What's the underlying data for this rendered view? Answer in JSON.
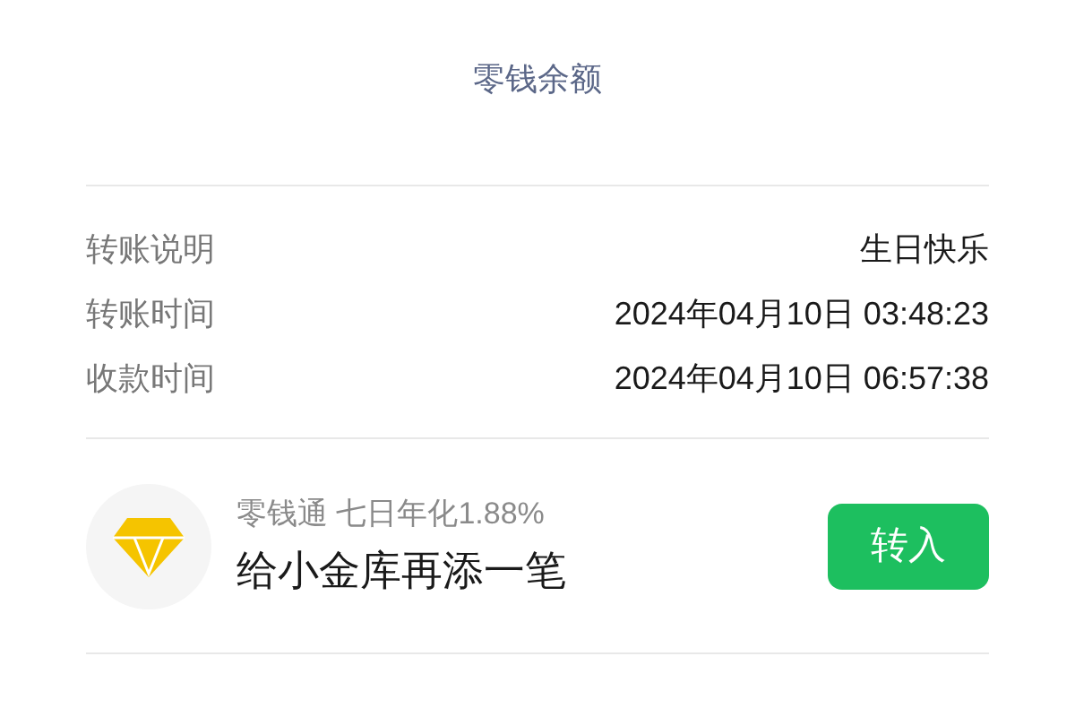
{
  "title": "零钱余额",
  "details": [
    {
      "label": "转账说明",
      "value": "生日快乐"
    },
    {
      "label": "转账时间",
      "value": "2024年04月10日 03:48:23"
    },
    {
      "label": "收款时间",
      "value": "2024年04月10日 06:57:38"
    }
  ],
  "promo": {
    "subtitle": "零钱通 七日年化1.88%",
    "headline": "给小金库再添一笔",
    "button": "转入"
  }
}
